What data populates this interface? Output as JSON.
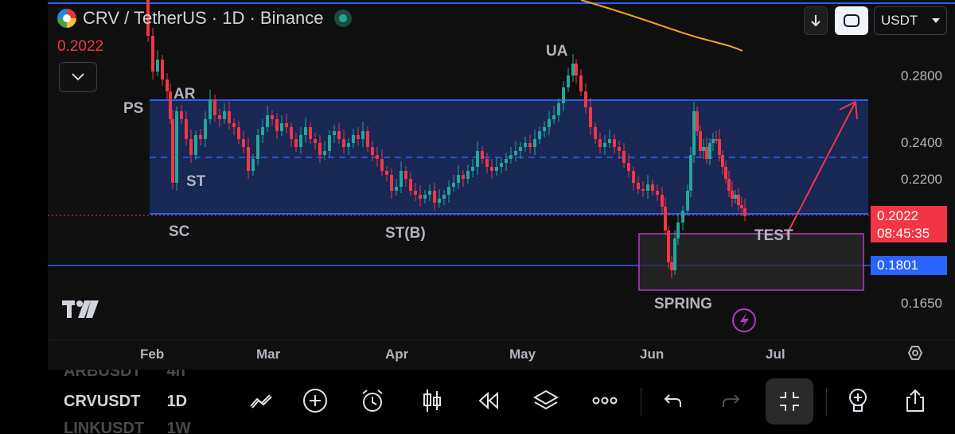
{
  "header": {
    "symbol_line": "CRV / TetherUS · 1D · Binance",
    "current_price": "0.2022",
    "currency": "USDT"
  },
  "price_axis": {
    "labels": [
      "0.2800",
      "0.2400",
      "0.2200",
      "0.1650"
    ]
  },
  "price_tags": {
    "last": "0.2022",
    "countdown": "08:45:35",
    "line": "0.1801"
  },
  "time_axis": {
    "labels": [
      "Feb",
      "Mar",
      "Apr",
      "May",
      "Jun",
      "Jul"
    ]
  },
  "annotations": {
    "ps": "PS",
    "ar": "AR",
    "st": "ST",
    "sc": "SC",
    "stb": "ST(B)",
    "ua": "UA",
    "spring": "SPRING",
    "test": "TEST"
  },
  "watchlist": {
    "row1_symbol": "ARBUSDT",
    "row1_interval": "4h",
    "row2_symbol": "CRVUSDT",
    "row2_interval": "1D",
    "row3_symbol": "LINKUSDT",
    "row3_interval": "1W"
  },
  "colors": {
    "bull": "#26a69a",
    "bear": "#f23645",
    "range_fill": "#1a2a5c",
    "range_line": "#2962ff",
    "ma": "#f5a623",
    "box": "#b03cc8",
    "arrow": "#f23645"
  },
  "toolbar": {
    "icons": [
      "trend-icon",
      "plus-icon",
      "alarm-icon",
      "candles-icon",
      "replay-icon",
      "layers-icon",
      "more-icon",
      "undo-icon",
      "redo-icon",
      "fullscreen-exit-icon",
      "idea-icon",
      "share-icon"
    ]
  }
}
